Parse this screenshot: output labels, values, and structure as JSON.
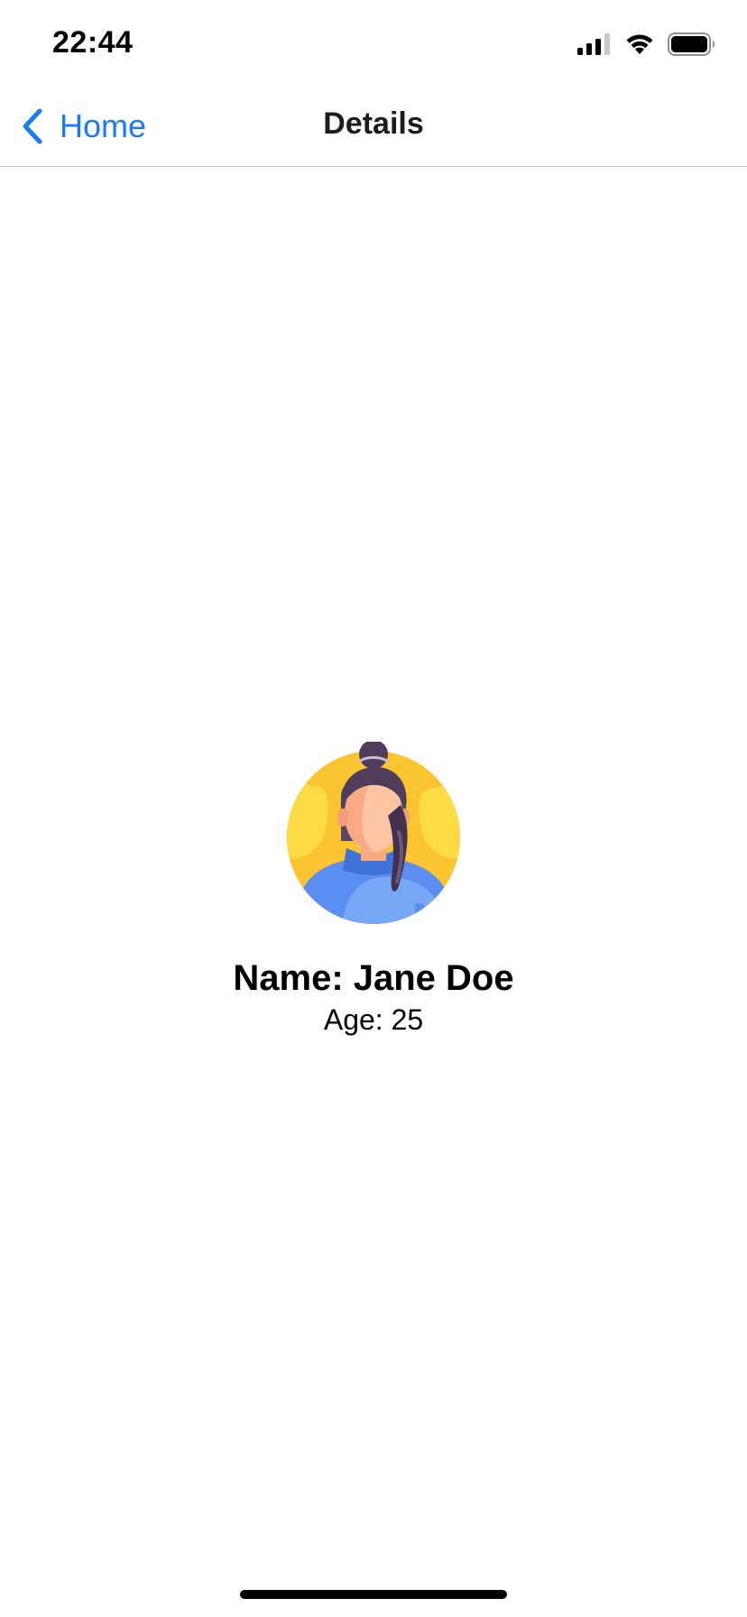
{
  "status_bar": {
    "time": "22:44",
    "icons": [
      "signal-icon",
      "wifi-icon",
      "battery-icon"
    ]
  },
  "nav": {
    "back_label": "Home",
    "title": "Details",
    "accent_color": "#1a7cf5"
  },
  "profile": {
    "avatar_icon": "woman-avatar-icon",
    "name": "Name: Jane Doe",
    "age": "Age: 25"
  }
}
